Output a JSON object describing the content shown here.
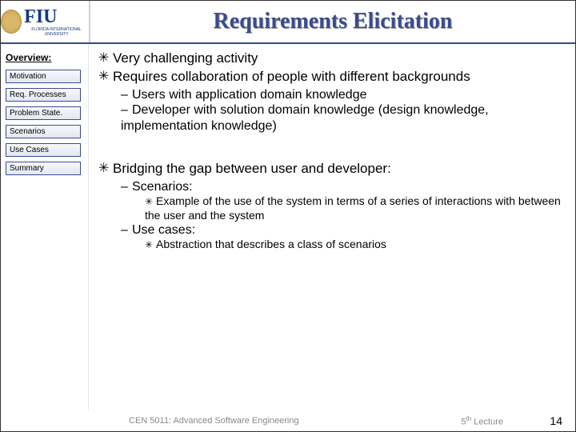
{
  "header": {
    "logo_main": "FIU",
    "logo_sub": "FLORIDA INTERNATIONAL UNIVERSITY",
    "title": "Requirements Elicitation"
  },
  "sidebar": {
    "heading": "Overview:",
    "items": [
      {
        "label": "Motivation"
      },
      {
        "label": "Req. Processes"
      },
      {
        "label": "Problem State."
      },
      {
        "label": "Scenarios"
      },
      {
        "label": "Use Cases"
      },
      {
        "label": "Summary"
      }
    ]
  },
  "content": {
    "b1": "Very challenging activity",
    "b2": "Requires collaboration of people with different backgrounds",
    "b2s1": "Users with application domain knowledge",
    "b2s2": "Developer with solution domain knowledge (design knowledge, implementation knowledge)",
    "b3": "Bridging the gap between user and developer:",
    "b3s1": "Scenarios:",
    "b3s1d": "Example of the use of the system in terms of a series of interactions with between the user and the system",
    "b3s2": "Use cases:",
    "b3s2d": "Abstraction that describes a class of scenarios"
  },
  "footer": {
    "course": "CEN 5011: Advanced Software Engineering",
    "lecture_pre": "5",
    "lecture_sup": "th",
    "lecture_post": " Lecture",
    "page": "14"
  }
}
